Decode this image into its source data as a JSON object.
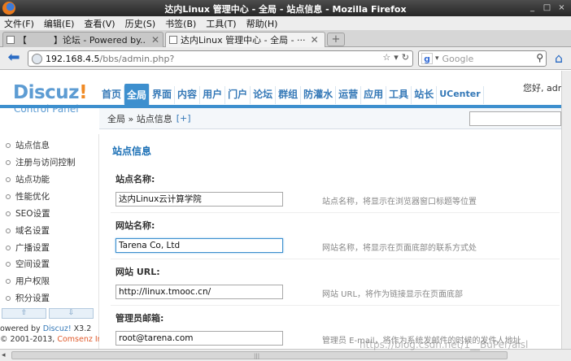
{
  "window": {
    "title": "达内Linux 管理中心 - 全局 - 站点信息 - Mozilla Firefox",
    "controls": [
      "_",
      "□",
      "×"
    ]
  },
  "menubar": {
    "items": [
      "文件(F)",
      "编辑(E)",
      "查看(V)",
      "历史(S)",
      "书签(B)",
      "工具(T)",
      "帮助(H)"
    ]
  },
  "tabs": [
    {
      "label": "【　　　】论坛 - Powered by...",
      "close": "✕",
      "active": false
    },
    {
      "label": "达内Linux 管理中心 - 全局 - ···",
      "close": "✕",
      "active": true
    }
  ],
  "newtab_label": "+",
  "navbar": {
    "url_host": "192.168.4.5",
    "url_path": "/bbs/admin.php?",
    "search_placeholder": "Google"
  },
  "logo": {
    "brand": "Discuz",
    "bang": "!",
    "subtitle": "Control Panel"
  },
  "topnav": {
    "items": [
      "首页",
      "全局",
      "界面",
      "内容",
      "用户",
      "门户",
      "论坛",
      "群组",
      "防灌水",
      "运营",
      "应用",
      "工具",
      "站长",
      "UCenter"
    ],
    "active_index": 1
  },
  "greeting": "您好, admi",
  "breadcrumb": {
    "text": "全局 » 站点信息",
    "plus": "[+]"
  },
  "sidebar": {
    "items": [
      "站点信息",
      "注册与访问控制",
      "站点功能",
      "性能优化",
      "SEO设置",
      "域名设置",
      "广播设置",
      "空间设置",
      "用户权限",
      "积分设置"
    ],
    "scroll_up": "⇧",
    "scroll_down": "⇩",
    "powered_prefix": "owered by ",
    "powered_link": "Discuz!",
    "powered_version": " X3.2",
    "copyright_prefix": "© 2001-2013, ",
    "copyright_brand": "Comsenz Inc."
  },
  "main": {
    "section_title": "站点信息",
    "fields": [
      {
        "label": "站点名称:",
        "value": "达内Linux云计算学院",
        "hint": "站点名称，将显示在浏览器窗口标题等位置"
      },
      {
        "label": "网站名称:",
        "value": "Tarena Co, Ltd",
        "hint": "网站名称，将显示在页面底部的联系方式处"
      },
      {
        "label": "网站 URL:",
        "value": "http://linux.tmooc.cn/",
        "hint": "网站 URL，将作为链接显示在页面底部"
      },
      {
        "label": "管理员邮箱:",
        "value": "root@tarena.com",
        "hint": "管理员 E-mail，将作为系统发邮件的时候的发件人地址"
      }
    ]
  },
  "watermark": "https://blog.csdn.net/1__BuPer/aisl",
  "colors": {
    "accent": "#3d8fce",
    "nav_text": "#3478b7",
    "logo_blue": "#5d9cd3",
    "logo_orange": "#f08a24"
  }
}
